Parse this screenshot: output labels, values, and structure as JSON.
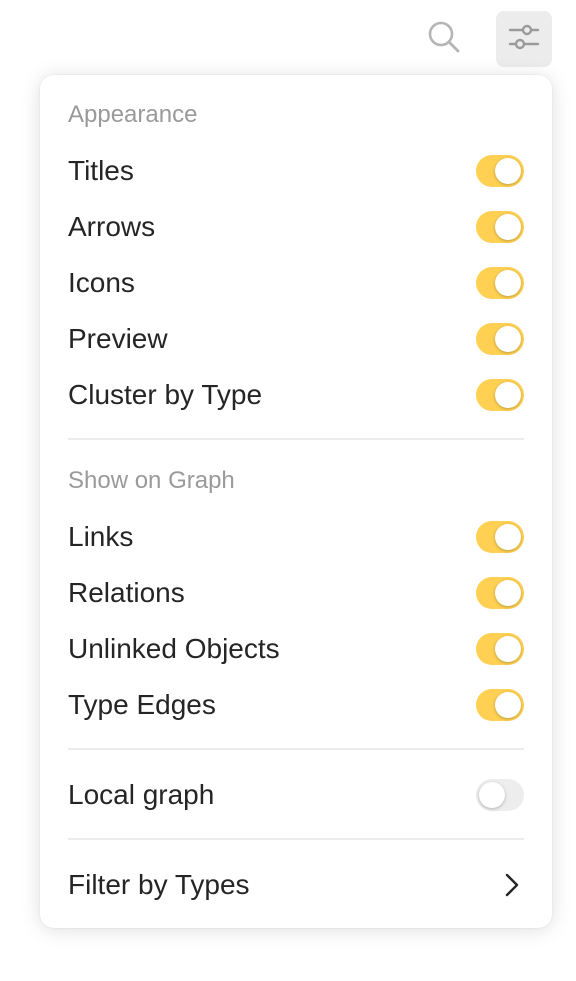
{
  "toolbar": {
    "search_icon": "search-icon",
    "settings_icon": "sliders-icon"
  },
  "colors": {
    "toggle_on": "#FFD052",
    "toggle_off": "#EDEDED",
    "section_title": "#9A9A9A",
    "label": "#252525",
    "divider": "#ECECEC"
  },
  "appearance": {
    "title": "Appearance",
    "items": [
      {
        "label": "Titles",
        "on": true
      },
      {
        "label": "Arrows",
        "on": true
      },
      {
        "label": "Icons",
        "on": true
      },
      {
        "label": "Preview",
        "on": true
      },
      {
        "label": "Cluster by Type",
        "on": true
      }
    ]
  },
  "show_on_graph": {
    "title": "Show on Graph",
    "items": [
      {
        "label": "Links",
        "on": true
      },
      {
        "label": "Relations",
        "on": true
      },
      {
        "label": "Unlinked Objects",
        "on": true
      },
      {
        "label": "Type Edges",
        "on": true
      }
    ]
  },
  "local_graph": {
    "label": "Local graph",
    "on": false
  },
  "filter": {
    "label": "Filter by Types",
    "icon": "chevron-right-icon"
  }
}
